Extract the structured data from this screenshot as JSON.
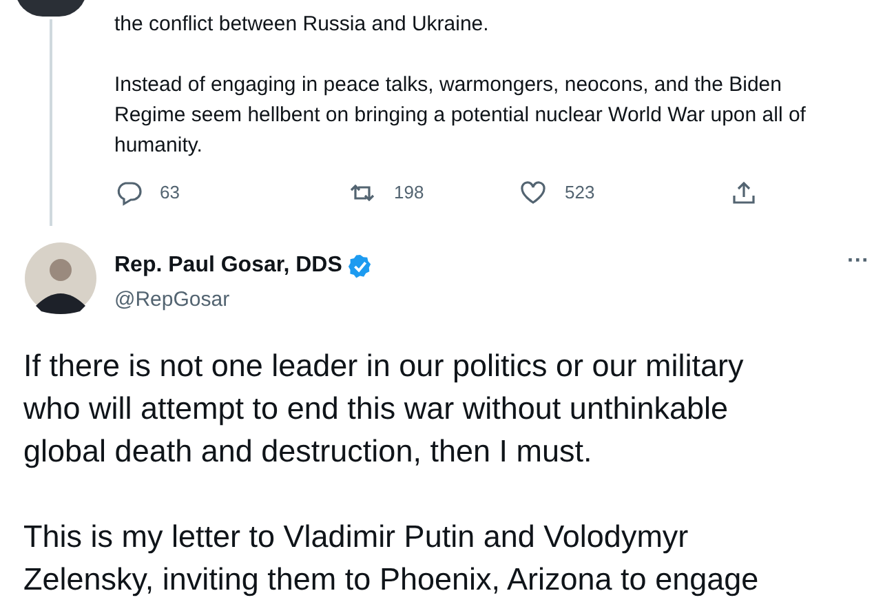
{
  "previous_tweet": {
    "paragraphs": [
      "the conflict between Russia and Ukraine.",
      "Instead of engaging in peace talks, warmongers, neocons, and the Biden Regime seem hellbent on bringing a potential nuclear World War upon all of humanity."
    ],
    "actions": [
      {
        "kind": "reply",
        "count": "63"
      },
      {
        "kind": "retweet",
        "count": "198"
      },
      {
        "kind": "like",
        "count": "523"
      },
      {
        "kind": "share"
      }
    ]
  },
  "tweet": {
    "name": "Rep. Paul Gosar, DDS",
    "verified": true,
    "handle": "@RepGosar",
    "more": "···",
    "paragraphs": [
      "If there is not one leader in our politics or our military who will attempt to end this war without unthinkable global death and destruction, then I must.",
      "This is my letter to Vladimir Putin and Volodymyr Zelensky, inviting them to Phoenix, Arizona to engage"
    ]
  }
}
